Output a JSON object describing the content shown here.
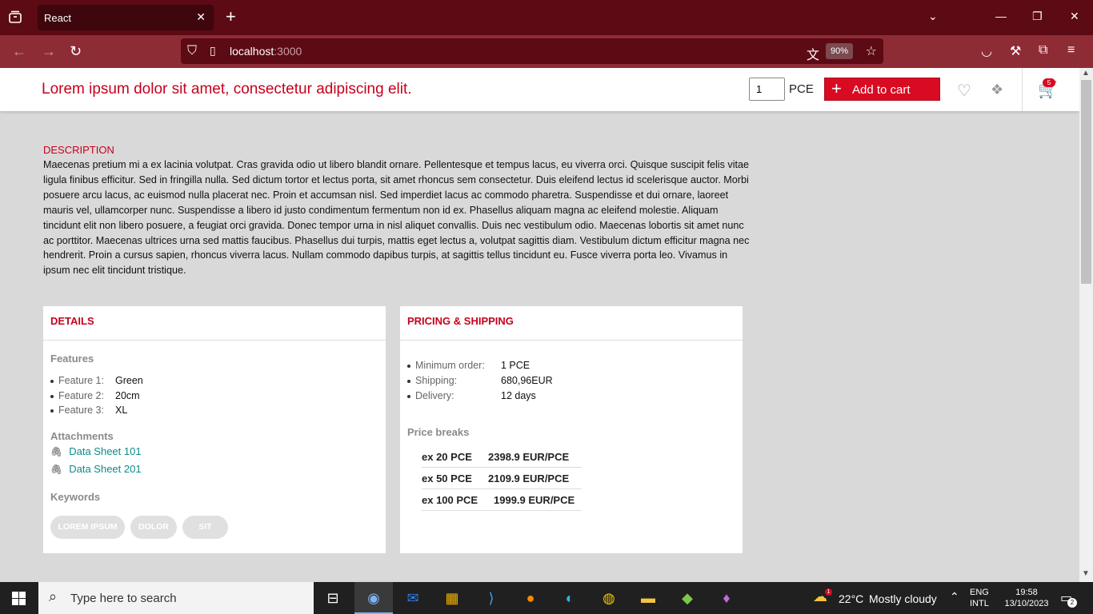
{
  "browser": {
    "tab_title": "React",
    "url_host": "localhost",
    "url_port": ":3000",
    "zoom": "90%"
  },
  "header": {
    "product_title": "Lorem ipsum dolor sit amet, consectetur adipiscing elit.",
    "quantity": "1",
    "unit": "PCE",
    "add_to_cart": "Add to cart",
    "cart_count": "5"
  },
  "description": {
    "heading": "DESCRIPTION",
    "text": "Maecenas pretium mi a ex lacinia volutpat. Cras gravida odio ut libero blandit ornare. Pellentesque et tempus lacus, eu viverra orci. Quisque suscipit felis vitae ligula finibus efficitur. Sed in fringilla nulla. Sed dictum tortor et lectus porta, sit amet rhoncus sem consectetur. Duis eleifend lectus id scelerisque auctor. Morbi posuere arcu lacus, ac euismod nulla placerat nec. Proin et accumsan nisl. Sed imperdiet lacus ac commodo pharetra. Suspendisse et dui ornare, laoreet mauris vel, ullamcorper nunc. Suspendisse a libero id justo condimentum fermentum non id ex. Phasellus aliquam magna ac eleifend molestie. Aliquam tincidunt elit non libero posuere, a feugiat orci gravida. Donec tempor urna in nisl aliquet convallis. Duis nec vestibulum odio. Maecenas lobortis sit amet nunc ac porttitor. Maecenas ultrices urna sed mattis faucibus. Phasellus dui turpis, mattis eget lectus a, volutpat sagittis diam. Vestibulum dictum efficitur magna nec hendrerit. Proin a cursus sapien, rhoncus viverra lacus. Nullam commodo dapibus turpis, at sagittis tellus tincidunt eu. Fusce viverra porta leo. Vivamus in ipsum nec elit tincidunt tristique."
  },
  "details": {
    "title": "DETAILS",
    "features_heading": "Features",
    "features": [
      {
        "label": "Feature 1:",
        "value": "Green"
      },
      {
        "label": "Feature 2:",
        "value": "20cm"
      },
      {
        "label": "Feature 3:",
        "value": "XL"
      }
    ],
    "attachments_heading": "Attachments",
    "attachments": [
      "Data Sheet 101",
      "Data Sheet 201"
    ],
    "keywords_heading": "Keywords",
    "keywords": [
      "LOREM IPSUM",
      "DOLOR",
      "SIT"
    ]
  },
  "pricing": {
    "title": "PRICING & SHIPPING",
    "rows": [
      {
        "label": "Minimum order:",
        "value": "1 PCE"
      },
      {
        "label": "Shipping:",
        "value": "680,96EUR"
      },
      {
        "label": "Delivery:",
        "value": "12 days"
      }
    ],
    "price_breaks_heading": "Price breaks",
    "price_breaks": [
      {
        "qty": "ex 20 PCE",
        "price": "2398.9 EUR/PCE"
      },
      {
        "qty": "ex 50 PCE",
        "price": "2109.9 EUR/PCE"
      },
      {
        "qty": "ex 100 PCE",
        "price": "1999.9 EUR/PCE"
      }
    ]
  },
  "taskbar": {
    "search_placeholder": "Type here to search",
    "weather_temp": "22°C",
    "weather_text": "Mostly cloudy",
    "lang_top": "ENG",
    "lang_bottom": "INTL",
    "time": "19:58",
    "date": "13/10/2023",
    "notification_count": "2",
    "weather_badge": "1"
  }
}
